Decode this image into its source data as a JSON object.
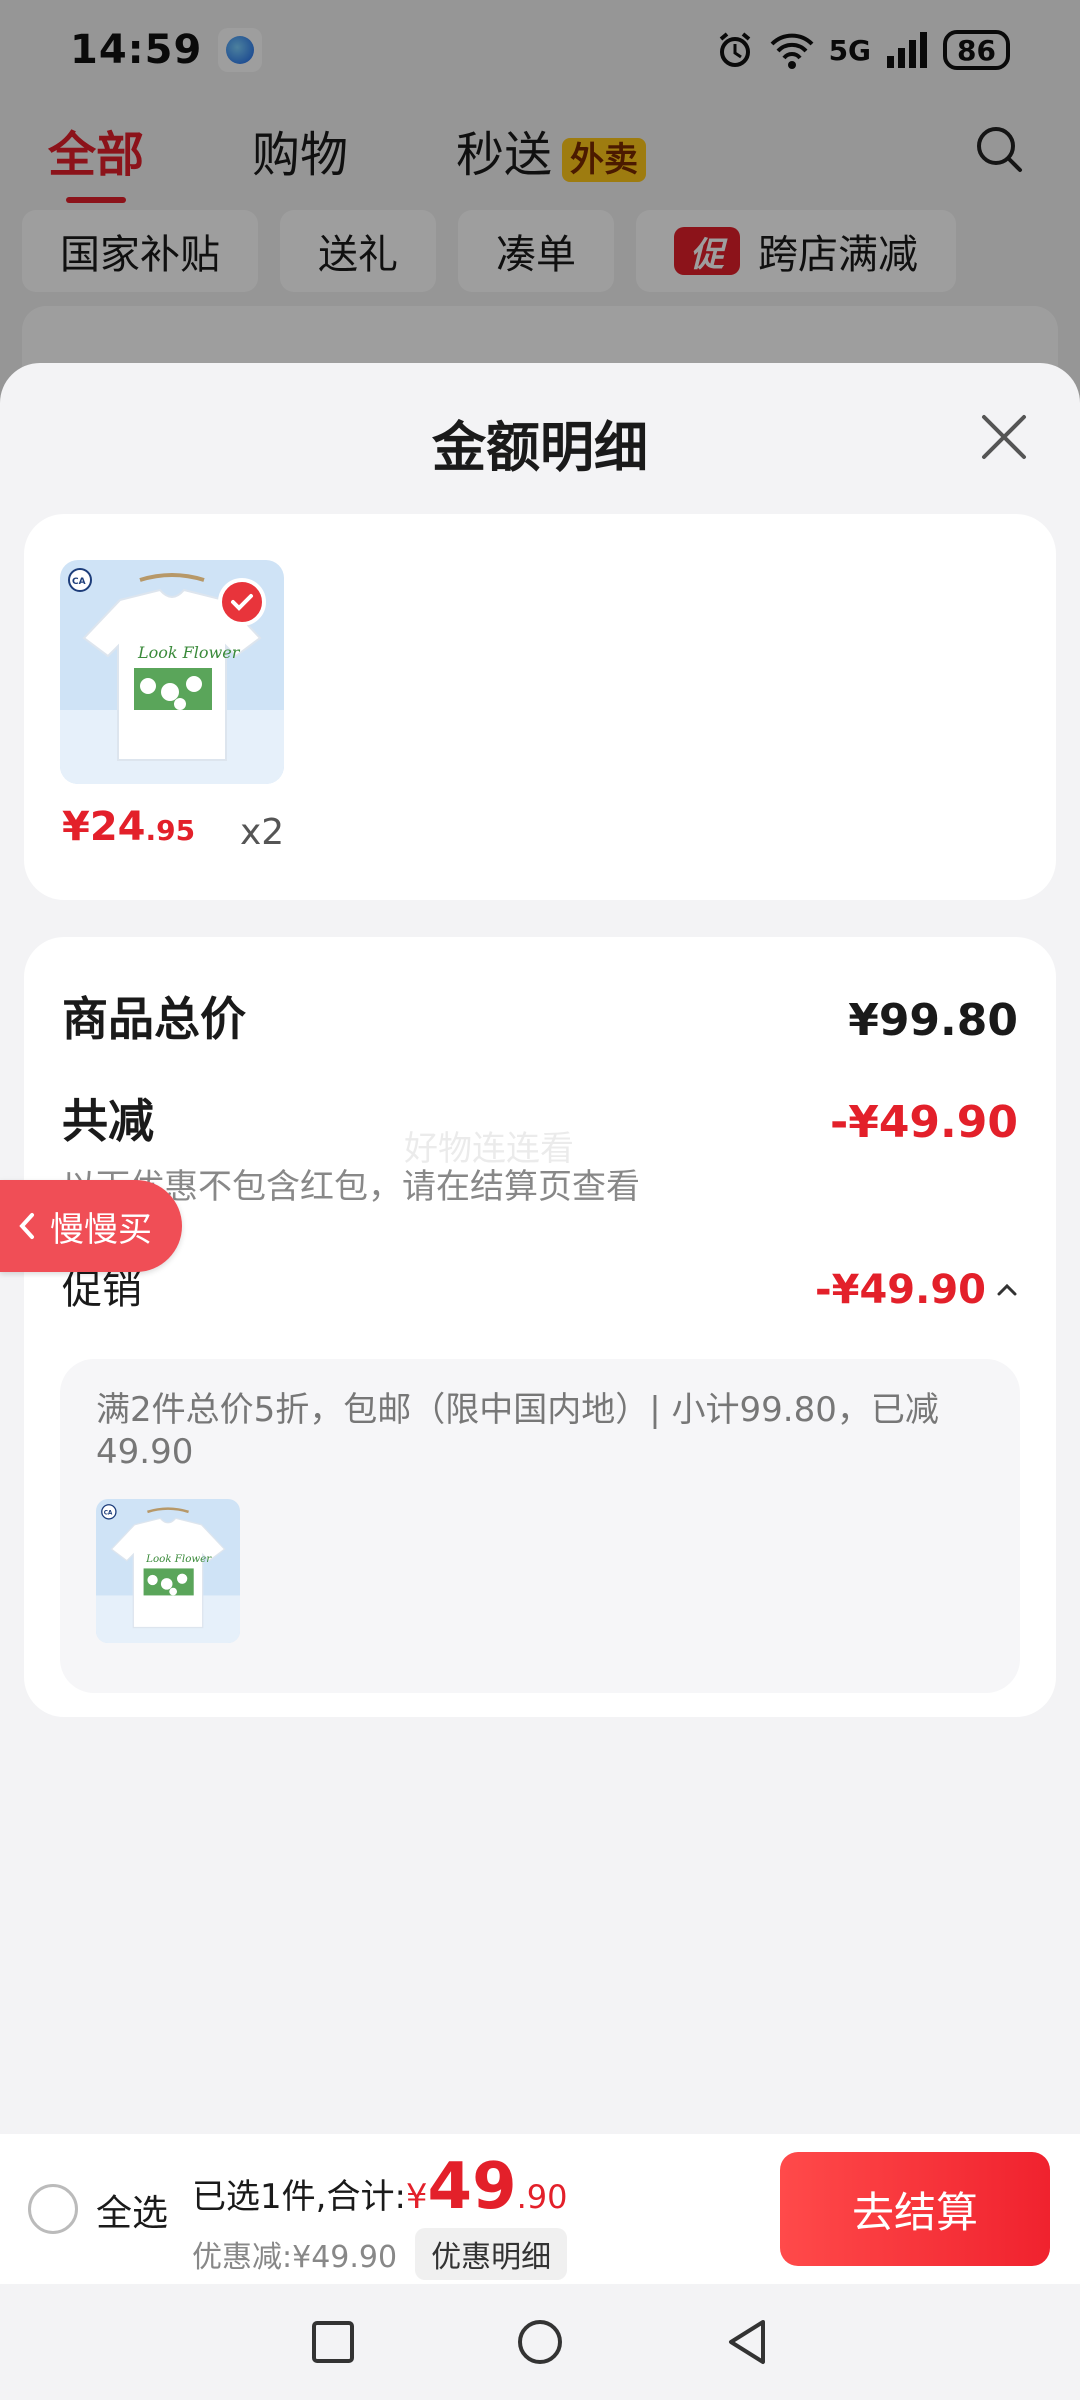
{
  "status_bar": {
    "time": "14:59",
    "signal": "5G",
    "battery": "86"
  },
  "top_tabs": [
    {
      "label": "全部"
    },
    {
      "label": "购物"
    },
    {
      "label": "秒送",
      "badge": "外卖"
    }
  ],
  "filter_chips": [
    {
      "label": "国家补贴"
    },
    {
      "label": "送礼"
    },
    {
      "label": "凑单"
    },
    {
      "label": "跨店满减",
      "badge": "促"
    }
  ],
  "sheet": {
    "title": "金额明细",
    "product": {
      "price_int": "¥24",
      "price_dec": ".95",
      "quantity": "x2"
    },
    "slow_buy": "慢慢买",
    "total": {
      "label": "商品总价",
      "amount": "¥99.80"
    },
    "reduce": {
      "label": "共减",
      "amount": "-¥49.90",
      "note": "以下优惠不包含红包，请在结算页查看"
    },
    "watermark": "好物连连看",
    "promo": {
      "label": "促销",
      "amount": "-¥49.90",
      "description": "满2件总价5折，包邮（限中国内地）| 小计99.80，已减49.90"
    }
  },
  "bottom_bar": {
    "select_all": "全选",
    "selected_prefix": "已选1件,合计:",
    "currency": "¥",
    "total_int": "49",
    "total_dec": ".90",
    "discount": "优惠减:¥49.90",
    "detail_button": "优惠明细",
    "checkout_button": "去结算"
  },
  "colors": {
    "accent_red": "#e3202a",
    "badge_yellow": "#ffc91a"
  },
  "icons": [
    "search-icon",
    "close-icon",
    "check-icon",
    "chevron-left-icon",
    "chevron-up-icon",
    "nav-recent-icon",
    "nav-home-icon",
    "nav-back-icon"
  ]
}
